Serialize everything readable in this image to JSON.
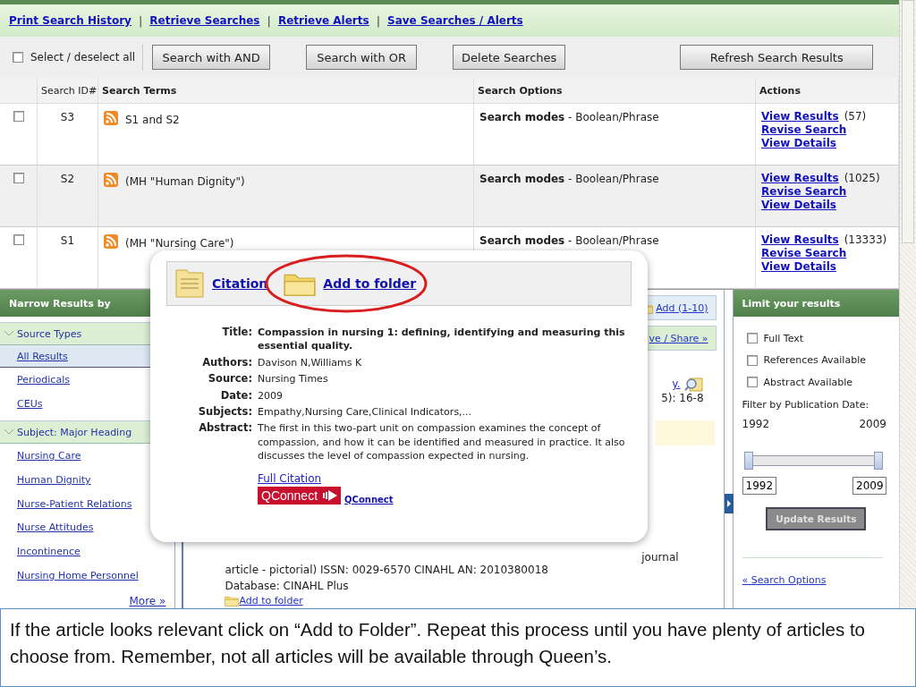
{
  "top_links": [
    "Print Search History",
    "Retrieve Searches",
    "Retrieve Alerts",
    "Save Searches / Alerts"
  ],
  "link_separator": "|",
  "toolbar": {
    "select_all": {
      "label": "Select / deselect all",
      "checked": false
    },
    "buttons": [
      "Search with AND",
      "Search with OR",
      "Delete Searches"
    ],
    "refresh_button": "Refresh Search Results"
  },
  "history_table": {
    "columns": [
      "Search ID#",
      "Search Terms",
      "Search Options",
      "Actions"
    ],
    "rows": [
      {
        "checked": false,
        "id": "S3",
        "terms": "S1 and S2",
        "option_label": "Search modes",
        "option_value": "- Boolean/Phrase",
        "view_results": "View Results",
        "count": "(57)",
        "revise": "Revise Search",
        "details": "View Details"
      },
      {
        "checked": false,
        "id": "S2",
        "terms": "(MH \"Human Dignity\")",
        "option_label": "Search modes",
        "option_value": "- Boolean/Phrase",
        "view_results": "View Results",
        "count": "(1025)",
        "revise": "Revise Search",
        "details": "View Details"
      },
      {
        "checked": false,
        "id": "S1",
        "terms": "(MH \"Nursing Care\")",
        "option_label": "Search modes",
        "option_value": "- Boolean/Phrase",
        "view_results": "View Results",
        "count": "(13333)",
        "revise": "Revise Search",
        "details": "View Details"
      }
    ]
  },
  "narrow_results": {
    "title": "Narrow Results by",
    "sections": [
      {
        "title": "Source Types",
        "expanded": true,
        "items": [
          {
            "label": "All Results",
            "selected": true
          },
          {
            "label": "Periodicals",
            "selected": false
          },
          {
            "label": "CEUs",
            "selected": false
          }
        ]
      },
      {
        "title": "Subject: Major Heading",
        "expanded": true,
        "items": [
          {
            "label": "Nursing Care",
            "selected": false
          },
          {
            "label": "Human Dignity",
            "selected": false
          },
          {
            "label": "Nurse-Patient Relations",
            "selected": false
          },
          {
            "label": "Nurse Attitudes",
            "selected": false
          },
          {
            "label": "Incontinence",
            "selected": false
          },
          {
            "label": "Nursing Home Personnel",
            "selected": false
          }
        ]
      }
    ],
    "more": "More »"
  },
  "results": {
    "add_link": "Add (1-10)",
    "share_link": "ve / Share »",
    "title_fragment": "y.",
    "source_fragment": "5): 16-8",
    "type_fragment": "journal",
    "details": "article - pictorial) ISSN: 0029-6570 CINAHL AN: 2010380018",
    "database": "Database: CINAHL Plus",
    "add_to_folder": "Add to folder"
  },
  "limit_panel": {
    "title": "Limit your results",
    "options": [
      {
        "label": "Full Text",
        "checked": false
      },
      {
        "label": "References Available",
        "checked": false
      },
      {
        "label": "Abstract Available",
        "checked": false
      }
    ],
    "date_label": "Filter by Publication Date:",
    "range_start": "1992",
    "range_end": "2009",
    "slider": {
      "handles": [
        {
          "level": 0
        },
        {
          "level": 1
        }
      ]
    },
    "from_value": "1992",
    "to_value": "2009",
    "update_button": {
      "label": "Update Results",
      "disabled": true
    },
    "search_options_link": "« Search Options"
  },
  "popup": {
    "citation_link": "Citation",
    "folder_link": "Add to folder",
    "highlighted": true,
    "fields": [
      {
        "label": "Title:",
        "value": "Compassion in nursing 1: defining, identifying and measuring this essential quality.",
        "bold": true
      },
      {
        "label": "Authors:",
        "value": "Davison N,Williams K",
        "bold": false
      },
      {
        "label": "Source:",
        "value": "Nursing Times",
        "bold": false
      },
      {
        "label": "Date:",
        "value": "2009",
        "bold": false
      },
      {
        "label": "Subjects:",
        "value": "Empathy,Nursing Care,Clinical Indicators,...",
        "bold": false
      },
      {
        "label": "Abstract:",
        "value": "The first in this two-part unit on compassion examines the concept of compassion, and how it can be identified and measured in practice. It also discusses the level of compassion expected in nursing.",
        "bold": false
      }
    ],
    "full_citation_link": "Full Citation",
    "qconnect_logo": "QConnect",
    "qconnect_link": "QConnect"
  },
  "caption": "If the article looks relevant click on “Add to Folder”. Repeat this process until you have plenty of articles to choose from. Remember, not all articles will be available through Queen’s."
}
